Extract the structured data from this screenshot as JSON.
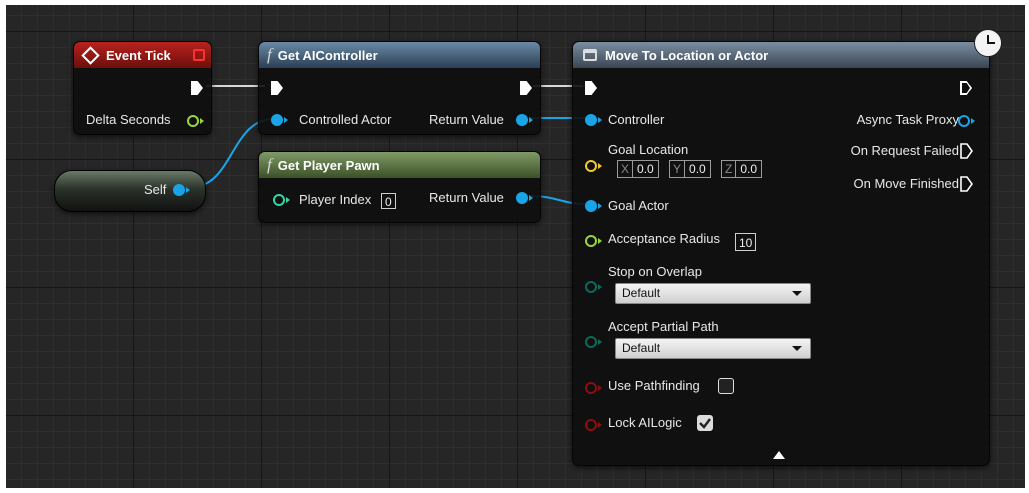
{
  "colors": {
    "exec": "#ffffff",
    "object": "#1aa4e8",
    "float": "#9ad53c",
    "int": "#2ed8a8",
    "vector": "#f0c830",
    "bool": "#8c0e0e",
    "byte": "#0b6b5a"
  },
  "event_tick": {
    "title": "Event Tick",
    "delta_seconds": "Delta Seconds"
  },
  "self_node": {
    "label": "Self"
  },
  "get_ai_controller": {
    "icon": "f",
    "title": "Get AIController",
    "controlled_actor": "Controlled Actor",
    "return_value": "Return Value"
  },
  "get_player_pawn": {
    "icon": "f",
    "title": "Get Player Pawn",
    "player_index_label": "Player Index",
    "player_index_value": "0",
    "return_value": "Return Value"
  },
  "move_to": {
    "title": "Move To Location or Actor",
    "controller": "Controller",
    "goal_location": "Goal Location",
    "goal_x_label": "X",
    "goal_x": "0.0",
    "goal_y_label": "Y",
    "goal_y": "0.0",
    "goal_z_label": "Z",
    "goal_z": "0.0",
    "goal_actor": "Goal Actor",
    "acceptance_radius_label": "Acceptance Radius",
    "acceptance_radius_value": "10",
    "stop_on_overlap_label": "Stop on Overlap",
    "stop_on_overlap_value": "Default",
    "accept_partial_path_label": "Accept Partial Path",
    "accept_partial_path_value": "Default",
    "use_pathfinding_label": "Use Pathfinding",
    "use_pathfinding": false,
    "lock_ailogic_label": "Lock AILogic",
    "lock_ailogic": true,
    "async_task_proxy": "Async Task Proxy",
    "on_request_failed": "On Request Failed",
    "on_move_finished": "On Move Finished"
  }
}
